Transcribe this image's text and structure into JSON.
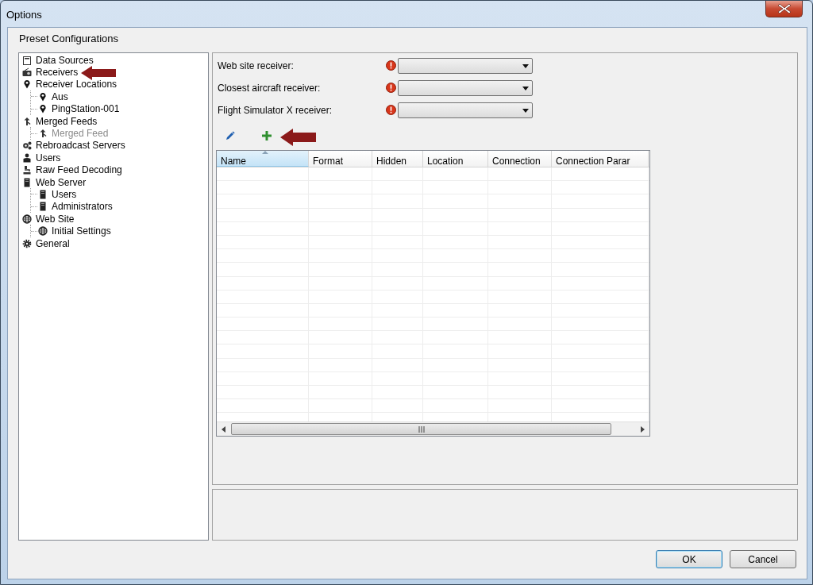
{
  "window": {
    "title": "Options"
  },
  "header": "Preset Configurations",
  "tree": [
    {
      "label": "Data Sources",
      "kind": "document",
      "disabled": false
    },
    {
      "label": "Receivers",
      "kind": "radio",
      "disabled": false
    },
    {
      "label": "Receiver Locations",
      "kind": "pin",
      "disabled": false,
      "children": [
        {
          "label": "Aus",
          "kind": "pin",
          "disabled": false
        },
        {
          "label": "PingStation-001",
          "kind": "pin",
          "disabled": false
        }
      ]
    },
    {
      "label": "Merged Feeds",
      "kind": "merge",
      "disabled": false,
      "children": [
        {
          "label": "Merged Feed",
          "kind": "merge",
          "disabled": true
        }
      ]
    },
    {
      "label": "Rebroadcast Servers",
      "kind": "gears",
      "disabled": false
    },
    {
      "label": "Users",
      "kind": "user",
      "disabled": false
    },
    {
      "label": "Raw Feed Decoding",
      "kind": "decoder",
      "disabled": false
    },
    {
      "label": "Web Server",
      "kind": "server",
      "disabled": false,
      "children": [
        {
          "label": "Users",
          "kind": "server",
          "disabled": false
        },
        {
          "label": "Administrators",
          "kind": "server",
          "disabled": false
        }
      ]
    },
    {
      "label": "Web Site",
      "kind": "globe",
      "disabled": false,
      "children": [
        {
          "label": "Initial Settings",
          "kind": "globe",
          "disabled": false
        }
      ]
    },
    {
      "label": "General",
      "kind": "gear",
      "disabled": false
    }
  ],
  "fields": [
    {
      "label": "Web site receiver:",
      "error": true
    },
    {
      "label": "Closest aircraft receiver:",
      "error": true
    },
    {
      "label": "Flight Simulator X receiver:",
      "error": true
    }
  ],
  "grid": {
    "columns": [
      {
        "label": "Name",
        "sorted": true
      },
      {
        "label": "Format",
        "sorted": false
      },
      {
        "label": "Hidden",
        "sorted": false
      },
      {
        "label": "Location",
        "sorted": false
      },
      {
        "label": "Connection",
        "sorted": false
      },
      {
        "label": "Connection Parar",
        "sorted": false
      }
    ]
  },
  "buttons": [
    {
      "label": "OK",
      "default": true
    },
    {
      "label": "Cancel",
      "default": false
    }
  ]
}
